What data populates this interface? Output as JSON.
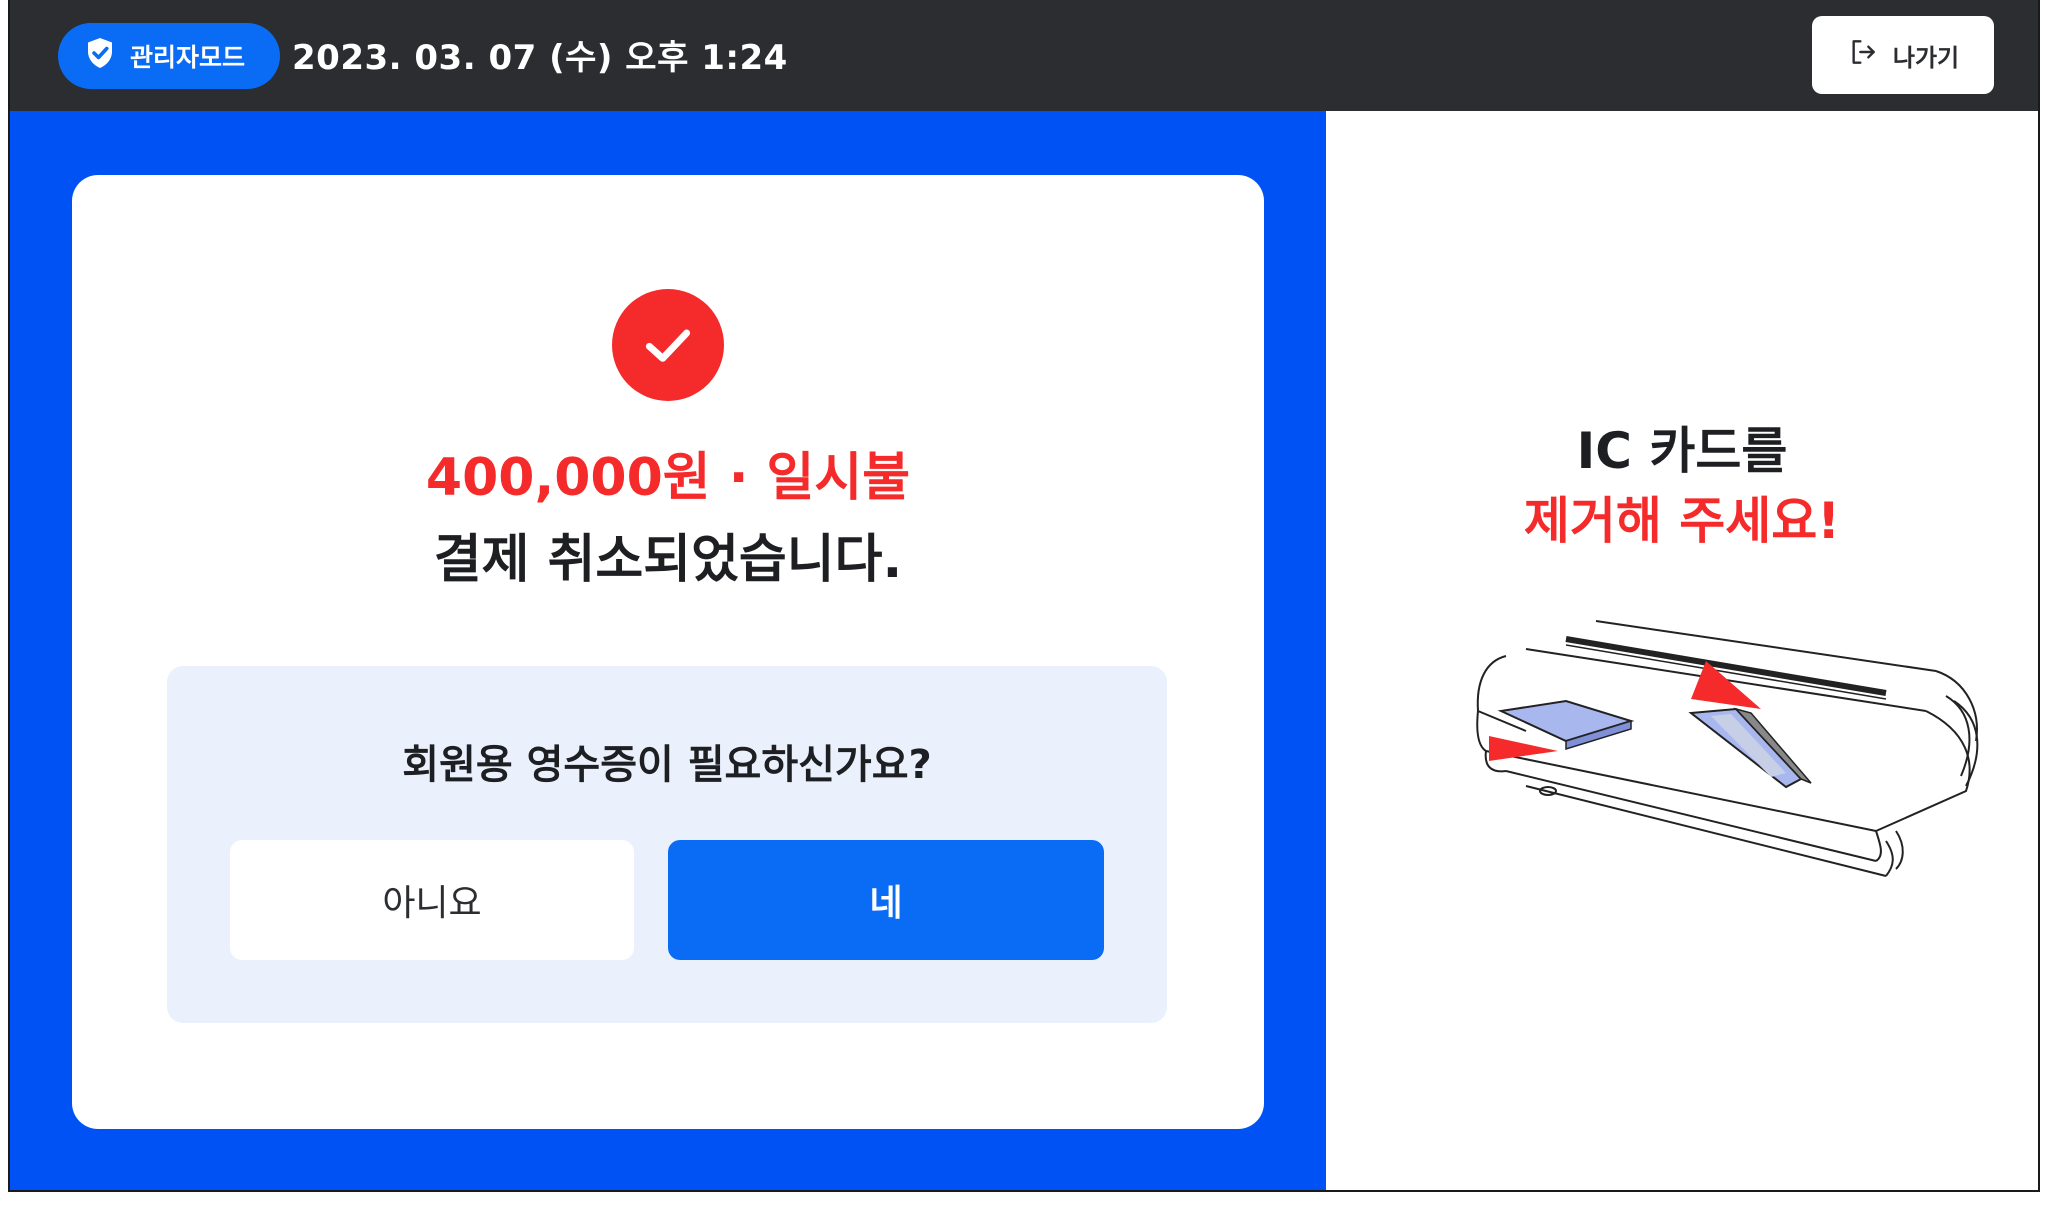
{
  "header": {
    "admin_badge": "관리자모드",
    "datetime": "2023. 03. 07 (수) 오후 1:24",
    "exit_label": "나가기"
  },
  "result": {
    "amount": "400,000원 · 일시불",
    "message": "결제 취소되었습니다."
  },
  "receipt": {
    "question": "회원용 영수증이 필요하신가요?",
    "no_label": "아니요",
    "yes_label": "네"
  },
  "card_instruction": {
    "line1": "IC 카드를",
    "line2": "제거해 주세요!"
  },
  "icons": {
    "admin": "shield-check-icon",
    "exit": "exit-icon",
    "success": "check-icon",
    "illustration": "card-terminal-illustration"
  },
  "colors": {
    "topbar": "#2b2d31",
    "primary_blue": "#0052f5",
    "button_blue": "#0a6cf5",
    "alert_red": "#f52a2a",
    "receipt_bg": "#eaf1fd"
  }
}
